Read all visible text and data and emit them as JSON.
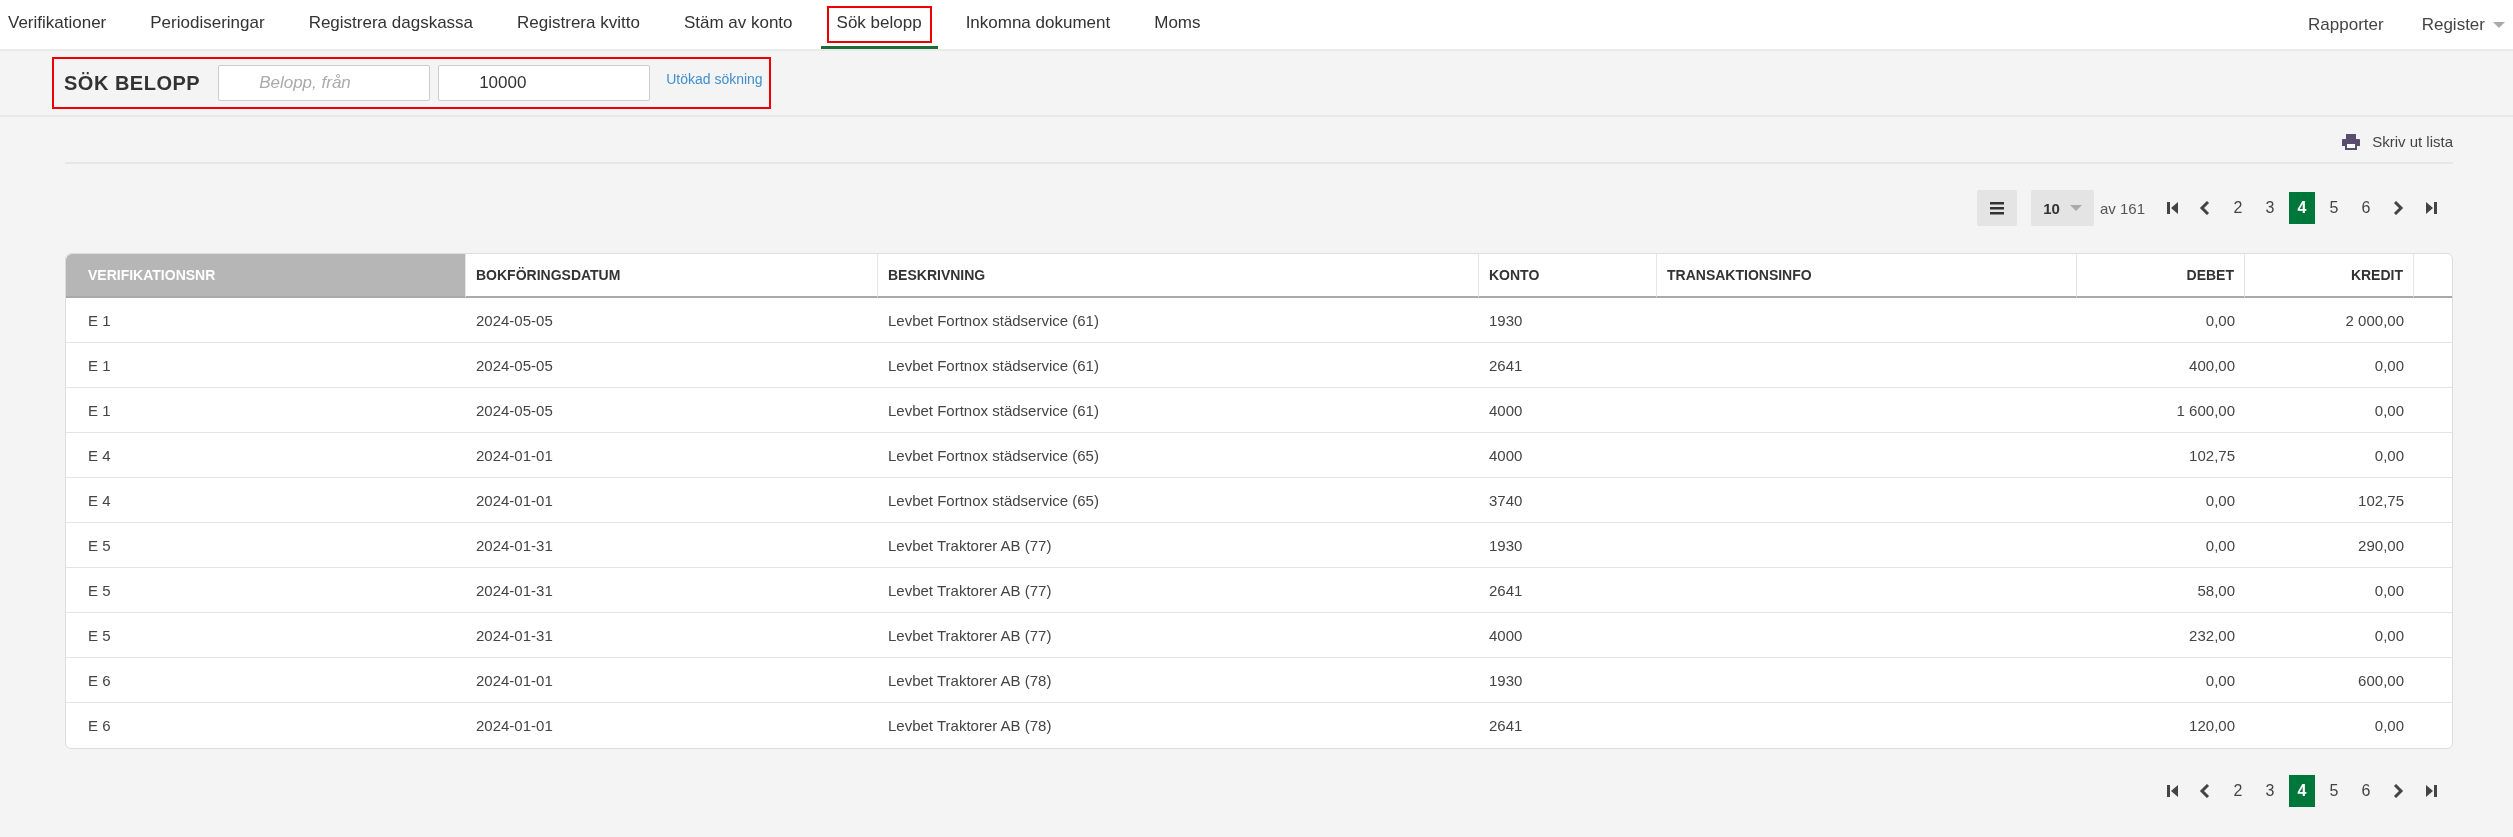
{
  "nav": {
    "tabs": [
      {
        "label": "Verifikationer",
        "selected": false,
        "highlighted": false
      },
      {
        "label": "Periodiseringar",
        "selected": false,
        "highlighted": false
      },
      {
        "label": "Registrera dagskassa",
        "selected": false,
        "highlighted": false
      },
      {
        "label": "Registrera kvitto",
        "selected": false,
        "highlighted": false
      },
      {
        "label": "Stäm av konto",
        "selected": false,
        "highlighted": false
      },
      {
        "label": "Sök belopp",
        "selected": true,
        "highlighted": true
      },
      {
        "label": "Inkomna dokument",
        "selected": false,
        "highlighted": false
      },
      {
        "label": "Moms",
        "selected": false,
        "highlighted": false
      }
    ],
    "menus": [
      {
        "label": "Rapporter",
        "dropdown": false
      },
      {
        "label": "Register",
        "dropdown": true
      }
    ]
  },
  "search": {
    "title": "SÖK BELOPP",
    "from": {
      "placeholder": "Belopp, från"
    },
    "to": {
      "value": "10000"
    },
    "advanced_link": "Utökad sökning",
    "highlighted": true
  },
  "print_link": "Skriv ut lista",
  "pagination_top": {
    "page_size": "10",
    "total": "av 161",
    "pages": [
      {
        "label": "2",
        "selected": false
      },
      {
        "label": "3",
        "selected": false
      },
      {
        "label": "4",
        "selected": true
      },
      {
        "label": "5",
        "selected": false
      },
      {
        "label": "6",
        "selected": false
      }
    ]
  },
  "table": {
    "columns": [
      {
        "label": "VERIFIKATIONSNR",
        "kind": "text",
        "sorted": true
      },
      {
        "label": "BOKFÖRINGSDATUM",
        "kind": "text",
        "sorted": false
      },
      {
        "label": "BESKRIVNING",
        "kind": "text",
        "sorted": false
      },
      {
        "label": "KONTO",
        "kind": "text",
        "sorted": false
      },
      {
        "label": "TRANSAKTIONSINFO",
        "kind": "text",
        "sorted": false
      },
      {
        "label": "DEBET",
        "kind": "amount",
        "sorted": false
      },
      {
        "label": "KREDIT",
        "kind": "amount",
        "sorted": false
      }
    ],
    "rows": [
      [
        "E 1",
        "2024-05-05",
        "Levbet Fortnox städservice (61)",
        "1930",
        "",
        "0,00",
        "2 000,00"
      ],
      [
        "E 1",
        "2024-05-05",
        "Levbet Fortnox städservice (61)",
        "2641",
        "",
        "400,00",
        "0,00"
      ],
      [
        "E 1",
        "2024-05-05",
        "Levbet Fortnox städservice (61)",
        "4000",
        "",
        "1 600,00",
        "0,00"
      ],
      [
        "E 4",
        "2024-01-01",
        "Levbet Fortnox städservice (65)",
        "4000",
        "",
        "102,75",
        "0,00"
      ],
      [
        "E 4",
        "2024-01-01",
        "Levbet Fortnox städservice (65)",
        "3740",
        "",
        "0,00",
        "102,75"
      ],
      [
        "E 5",
        "2024-01-31",
        "Levbet Traktorer AB (77)",
        "1930",
        "",
        "0,00",
        "290,00"
      ],
      [
        "E 5",
        "2024-01-31",
        "Levbet Traktorer AB (77)",
        "2641",
        "",
        "58,00",
        "0,00"
      ],
      [
        "E 5",
        "2024-01-31",
        "Levbet Traktorer AB (77)",
        "4000",
        "",
        "232,00",
        "0,00"
      ],
      [
        "E 6",
        "2024-01-01",
        "Levbet Traktorer AB (78)",
        "1930",
        "",
        "0,00",
        "600,00"
      ],
      [
        "E 6",
        "2024-01-01",
        "Levbet Traktorer AB (78)",
        "2641",
        "",
        "120,00",
        "0,00"
      ]
    ]
  },
  "pagination_bottom": {
    "pages": [
      {
        "label": "2",
        "selected": false
      },
      {
        "label": "3",
        "selected": false
      },
      {
        "label": "4",
        "selected": true
      },
      {
        "label": "5",
        "selected": false
      },
      {
        "label": "6",
        "selected": false
      }
    ]
  }
}
